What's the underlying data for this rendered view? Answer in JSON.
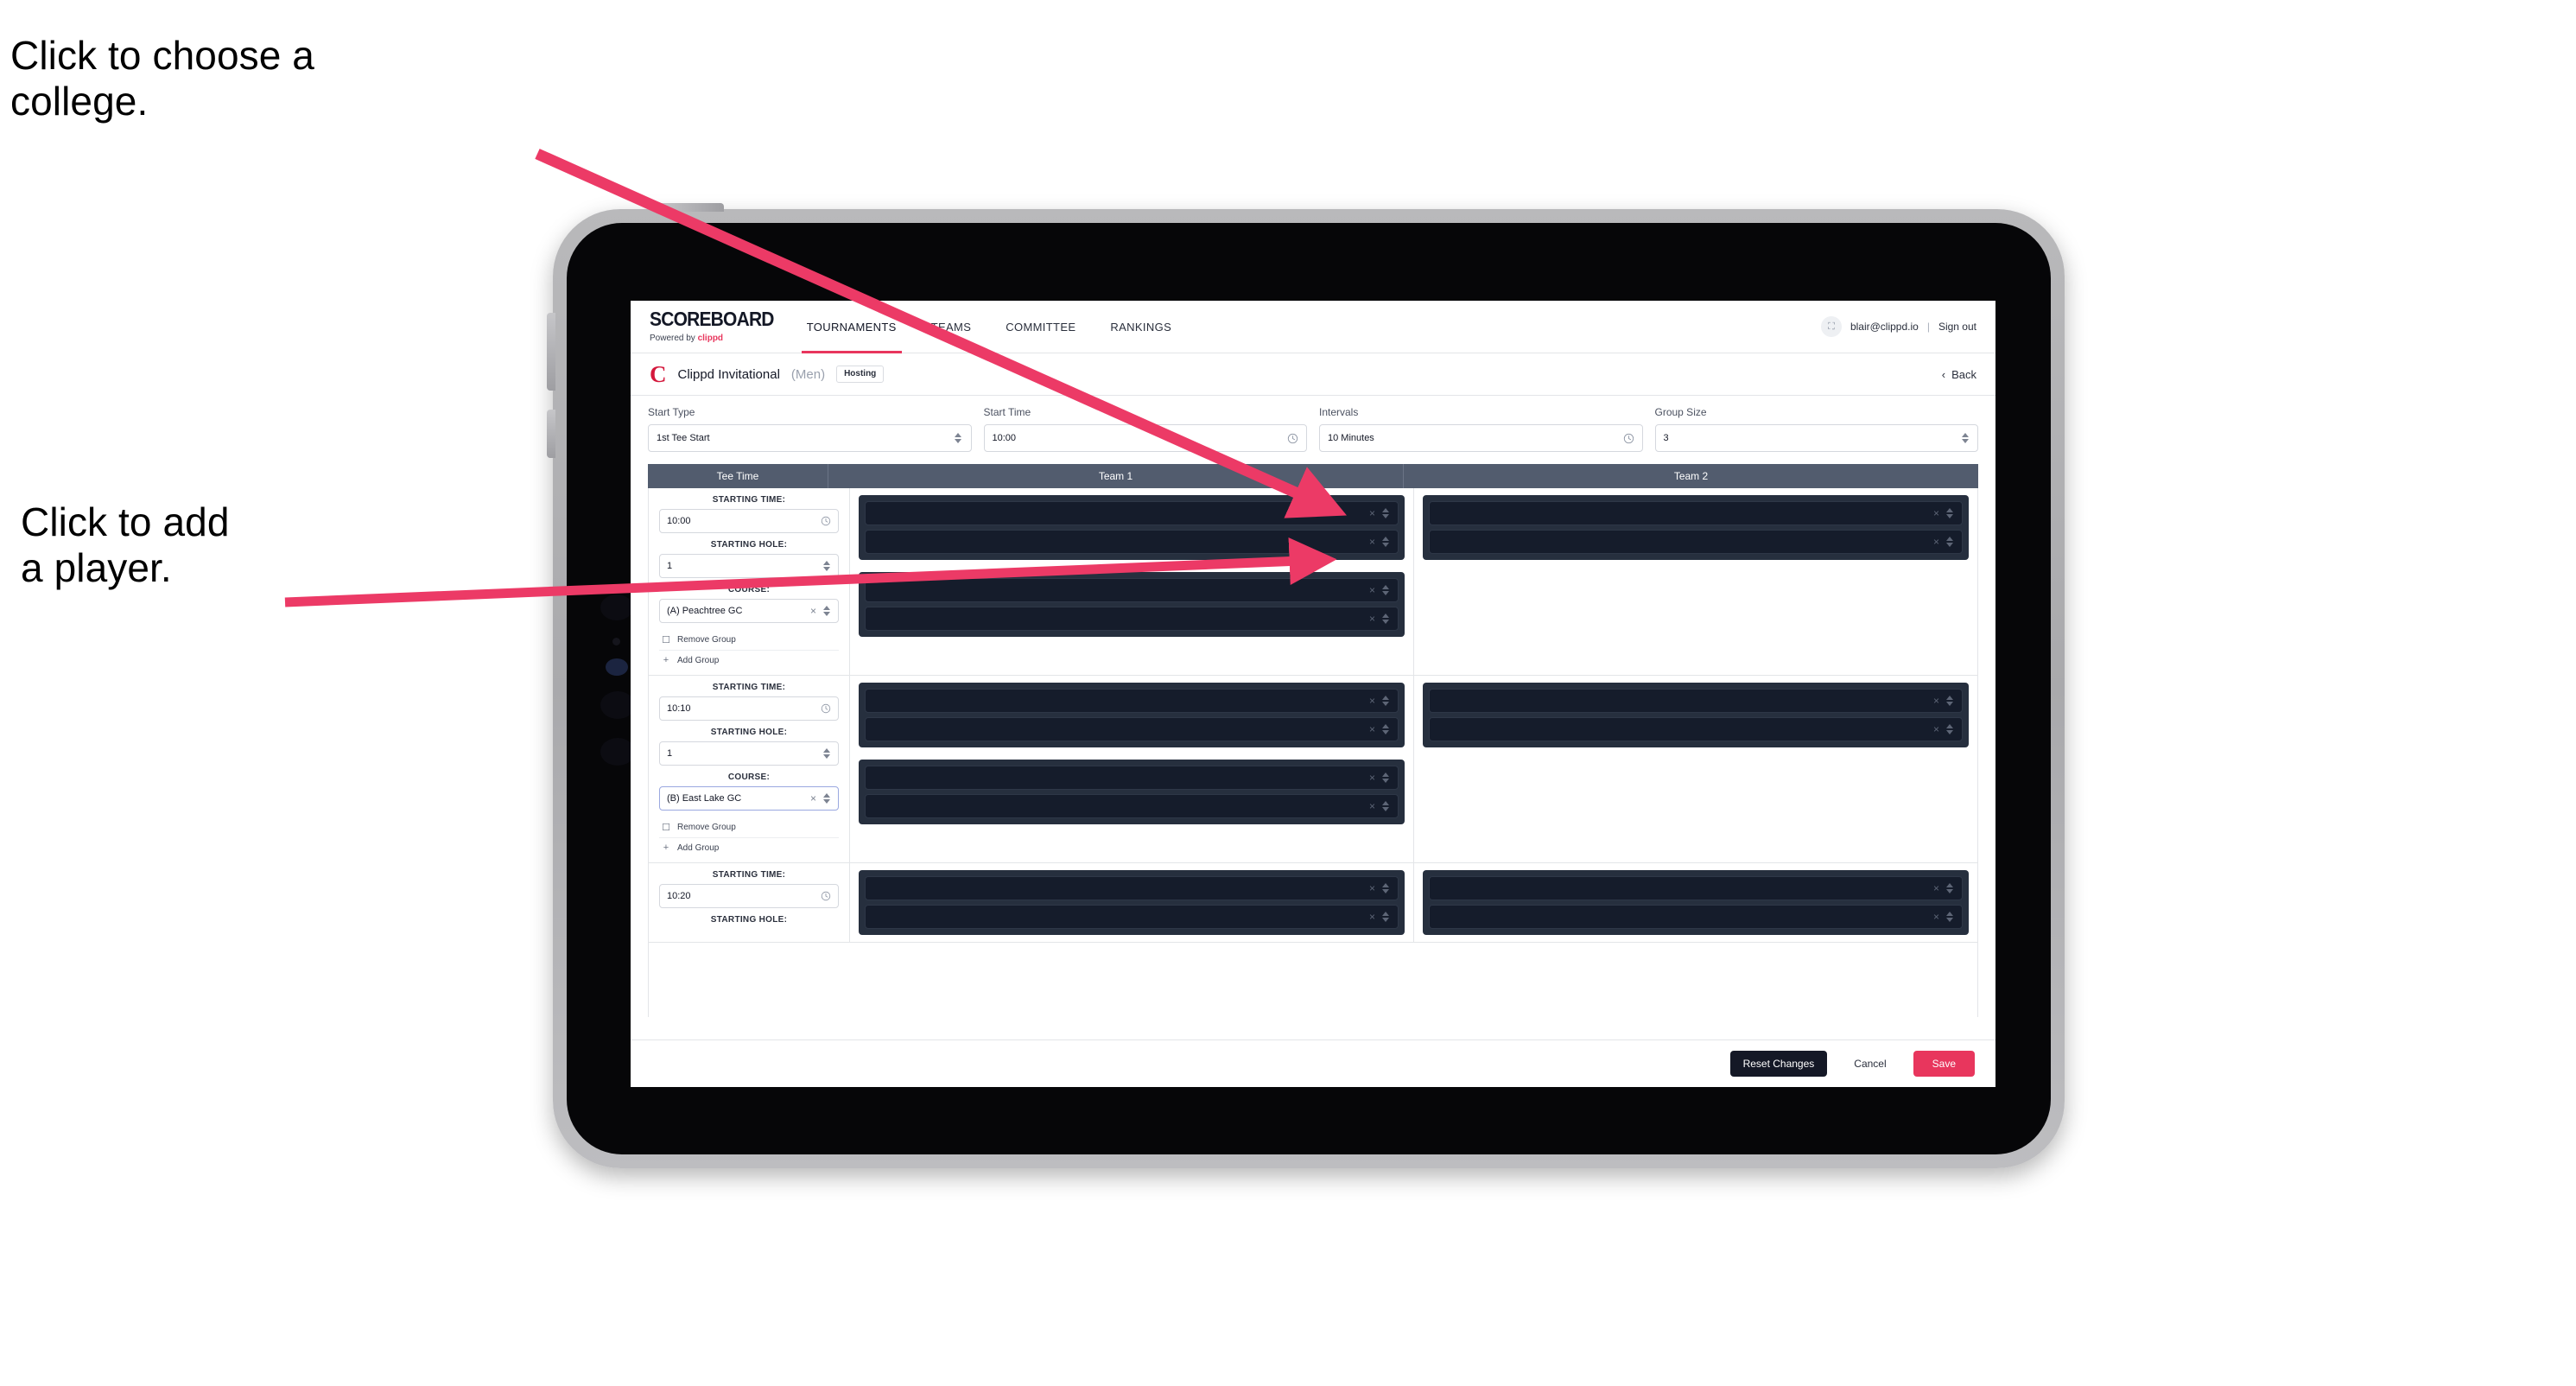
{
  "annotations": [
    {
      "id": "college",
      "text": "Click to choose a\ncollege."
    },
    {
      "id": "player",
      "text": "Click to add\na player."
    }
  ],
  "colors": {
    "accent_pink": "#e8365d",
    "brand_red": "#d4183c",
    "table_header": "#525c6e",
    "group_panel": "#262f3e",
    "player_slot": "#151c2b",
    "dark_button": "#141826"
  },
  "nav": {
    "brand_word": "SCOREBOARD",
    "brand_powered_prefix": "Powered by ",
    "brand_powered_name": "clippd",
    "tabs": [
      {
        "label": "TOURNAMENTS",
        "active": true
      },
      {
        "label": "TEAMS",
        "active": false
      },
      {
        "label": "COMMITTEE",
        "active": false
      },
      {
        "label": "RANKINGS",
        "active": false
      }
    ],
    "account": {
      "avatar_glyph": "⛶",
      "email": "blair@clippd.io",
      "divider": "|",
      "sign_out": "Sign out"
    }
  },
  "tournament_bar": {
    "logo_letter": "C",
    "name": "Clippd Invitational",
    "gender": "(Men)",
    "hosting_badge": "Hosting",
    "back_chevron": "‹",
    "back_label": "Back"
  },
  "settings": [
    {
      "label": "Start Type",
      "value": "1st Tee Start",
      "control": "select",
      "icon": "stepper-icon",
      "name": "start-type"
    },
    {
      "label": "Start Time",
      "value": "10:00",
      "control": "time",
      "icon": "clock-icon",
      "name": "start-time"
    },
    {
      "label": "Intervals",
      "value": "10 Minutes",
      "control": "time",
      "icon": "clock-icon",
      "name": "intervals"
    },
    {
      "label": "Group Size",
      "value": "3",
      "control": "select",
      "icon": "stepper-icon",
      "name": "group-size"
    }
  ],
  "table": {
    "headers": [
      "Tee Time",
      "Team 1",
      "Team 2"
    ],
    "labels": {
      "starting_time": "STARTING TIME:",
      "starting_hole": "STARTING HOLE:",
      "course": "COURSE:",
      "remove_group": "Remove Group",
      "add_group": "Add Group",
      "clock_icon": "clock-icon",
      "clear_icon": "×",
      "trash_icon": "☐",
      "plus_icon": "+"
    },
    "rows": [
      {
        "starting_time": "10:00",
        "starting_hole": "1",
        "course": "(A) Peachtree GC",
        "course_focused": false,
        "team1_groups": [
          {
            "slots": [
              "",
              ""
            ]
          },
          {
            "slots": [
              "",
              ""
            ]
          }
        ],
        "team2_groups": [
          {
            "slots": [
              "",
              ""
            ]
          }
        ]
      },
      {
        "starting_time": "10:10",
        "starting_hole": "1",
        "course": "(B) East Lake GC",
        "course_focused": true,
        "team1_groups": [
          {
            "slots": [
              "",
              ""
            ]
          },
          {
            "slots": [
              "",
              ""
            ]
          }
        ],
        "team2_groups": [
          {
            "slots": [
              "",
              ""
            ]
          }
        ]
      },
      {
        "starting_time": "10:20",
        "starting_hole": "",
        "course": "",
        "course_focused": false,
        "team1_groups": [
          {
            "slots": [
              "",
              ""
            ]
          }
        ],
        "team2_groups": [
          {
            "slots": [
              "",
              ""
            ]
          }
        ]
      }
    ]
  },
  "footer": {
    "reset_label": "Reset Changes",
    "cancel_label": "Cancel",
    "save_label": "Save"
  }
}
